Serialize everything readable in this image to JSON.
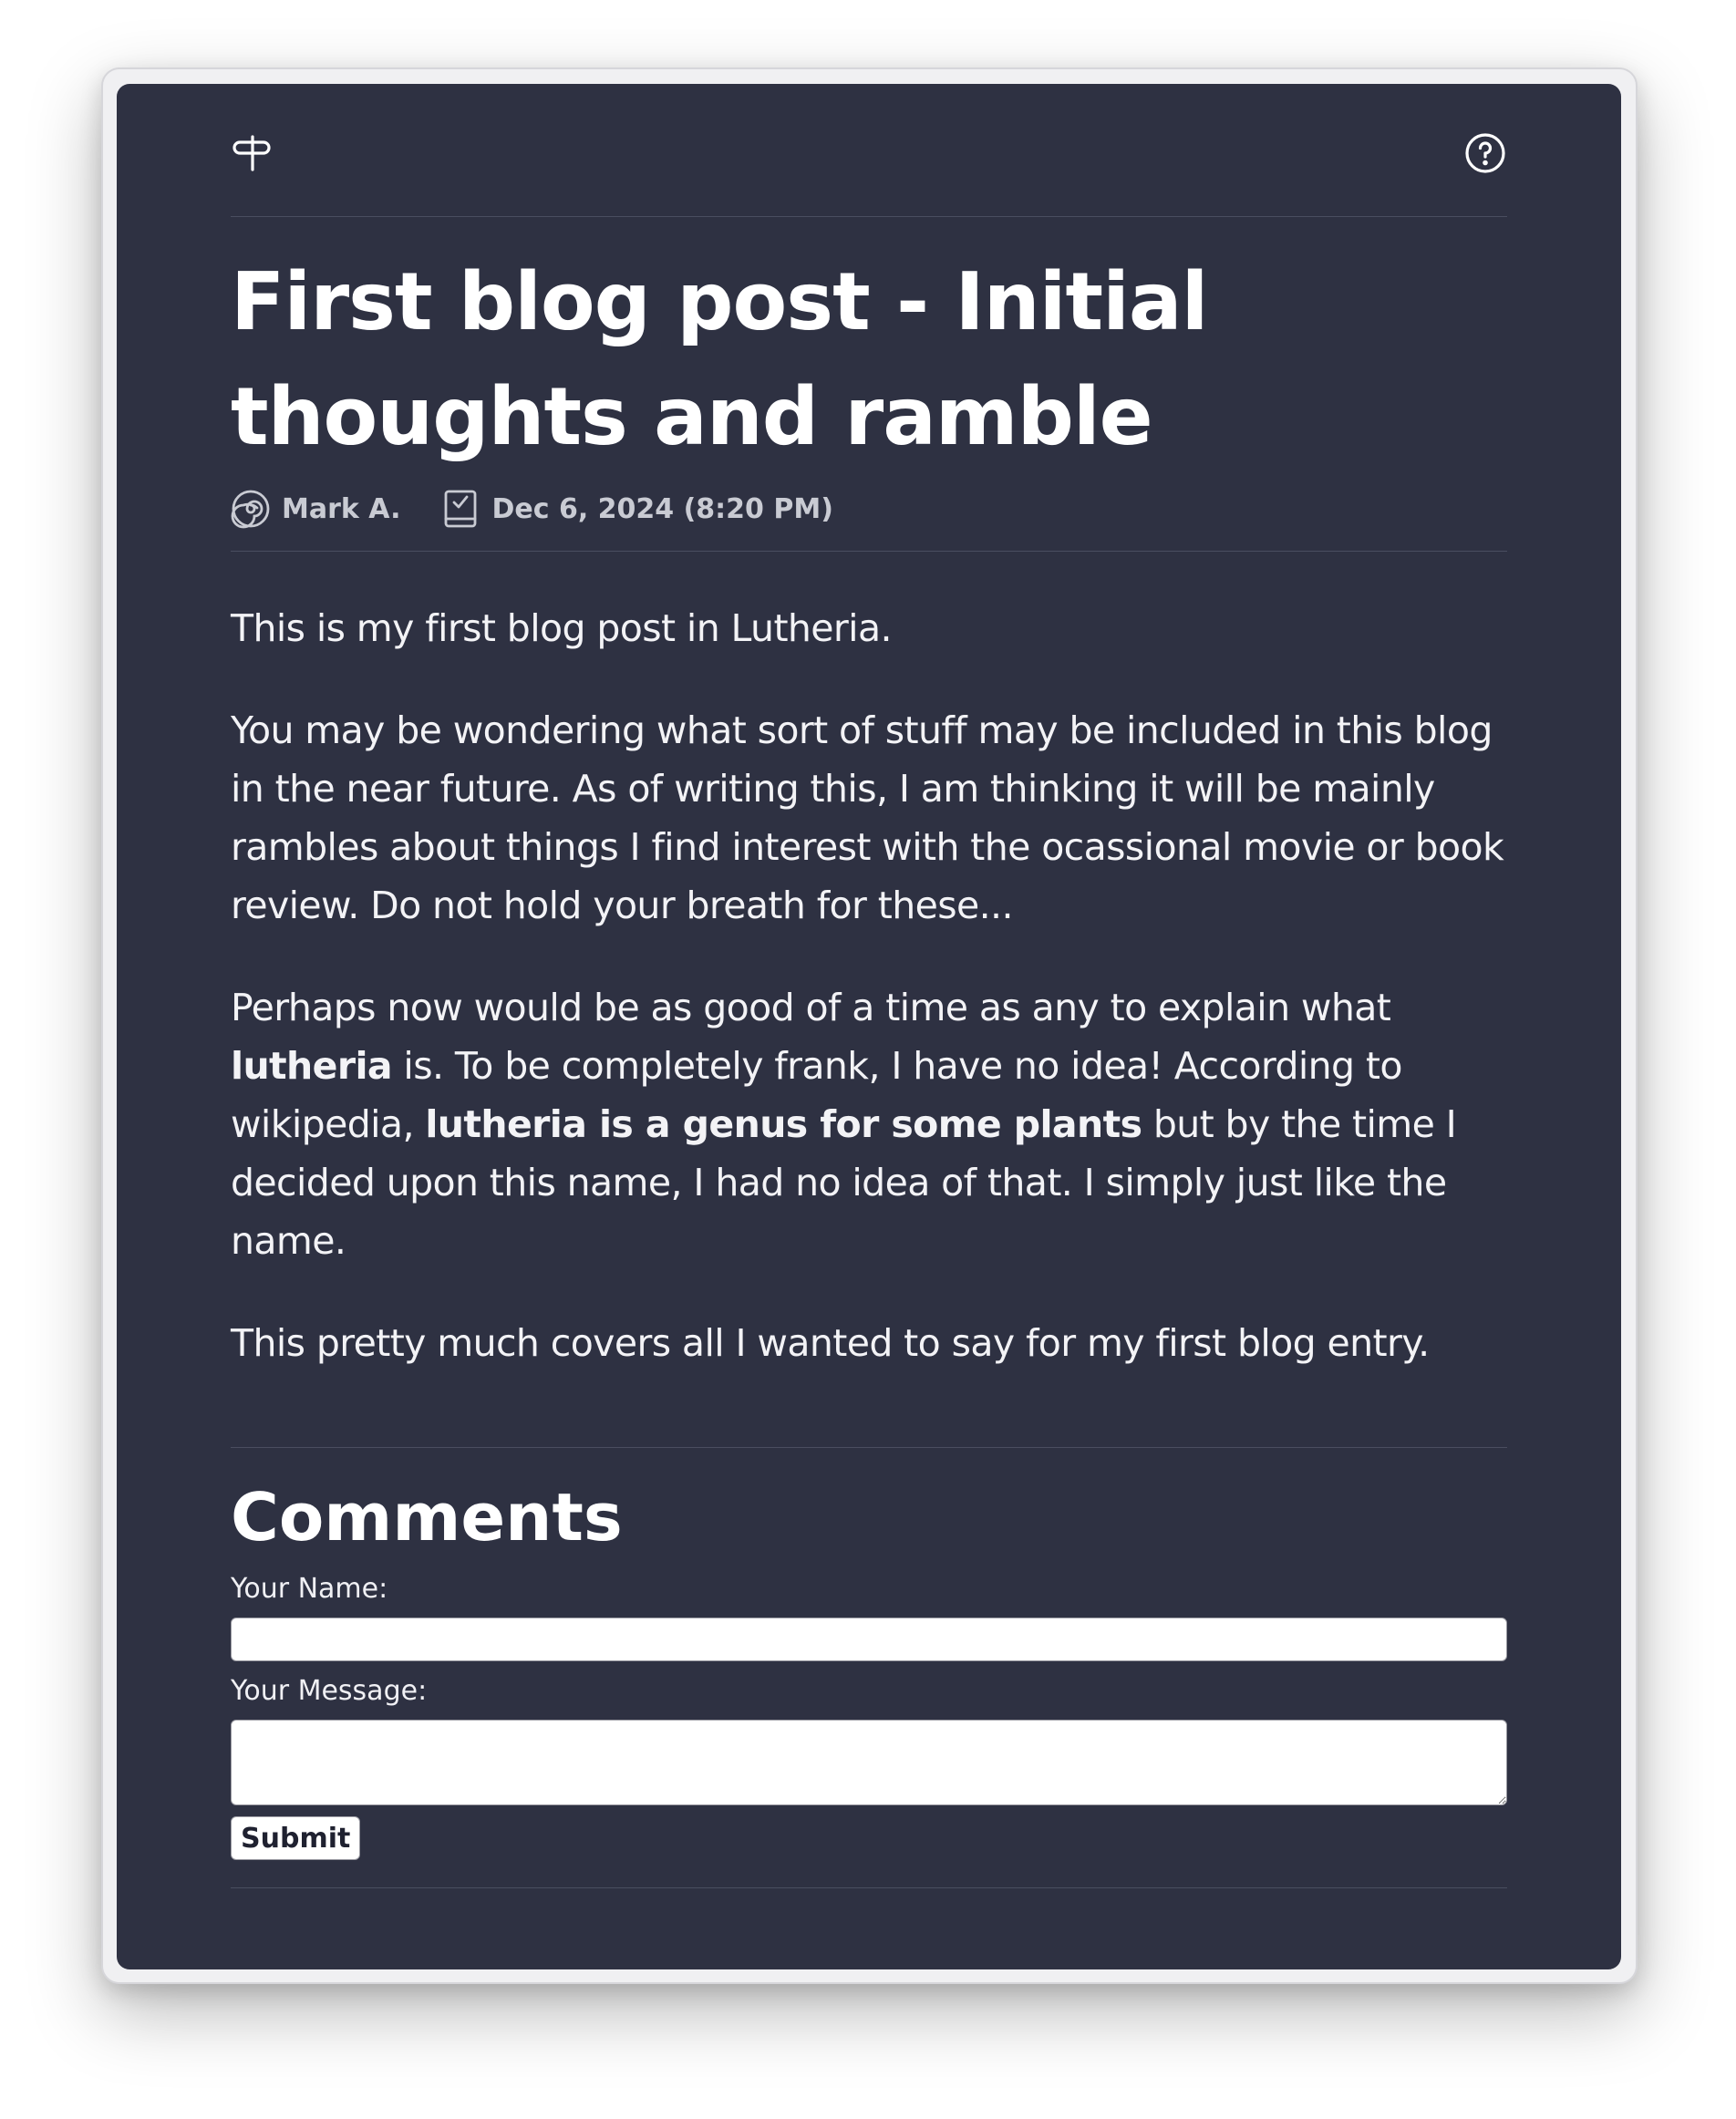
{
  "header": {
    "logo_icon": "signpost-icon",
    "help_icon": "help-circle-icon"
  },
  "post": {
    "title": "First blog post - Initial thoughts and ramble",
    "author": "Mark A.",
    "author_icon": "spiral-icon",
    "date": "Dec 6, 2024 (8:20 PM)",
    "date_icon": "clipboard-check-icon",
    "paragraphs": {
      "p1": "This is my first blog post in Lutheria.",
      "p2": "You may be wondering what sort of stuff may be included in this blog in the near future. As of writing this, I am thinking it will be mainly rambles about things I find interest with the ocassional movie or book review. Do not hold your breath for these...",
      "p3_a": "Perhaps now would be as good of a time as any to explain what ",
      "p3_b": "lutheria",
      "p3_c": " is. To be completely frank, I have no idea! According to wikipedia, ",
      "p3_d": "lutheria is a genus for some plants",
      "p3_e": " but by the time I decided upon this name, I had no idea of that. I simply just like the name.",
      "p4": "This pretty much covers all I wanted to say for my first blog entry."
    }
  },
  "comments": {
    "title": "Comments",
    "name_label": "Your Name:",
    "name_value": "",
    "message_label": "Your Message:",
    "message_value": "",
    "submit_label": "Submit"
  },
  "colors": {
    "background": "#2e3142",
    "text": "#ffffff",
    "meta_text": "#c9cbd3",
    "divider": "#4a4e60"
  }
}
